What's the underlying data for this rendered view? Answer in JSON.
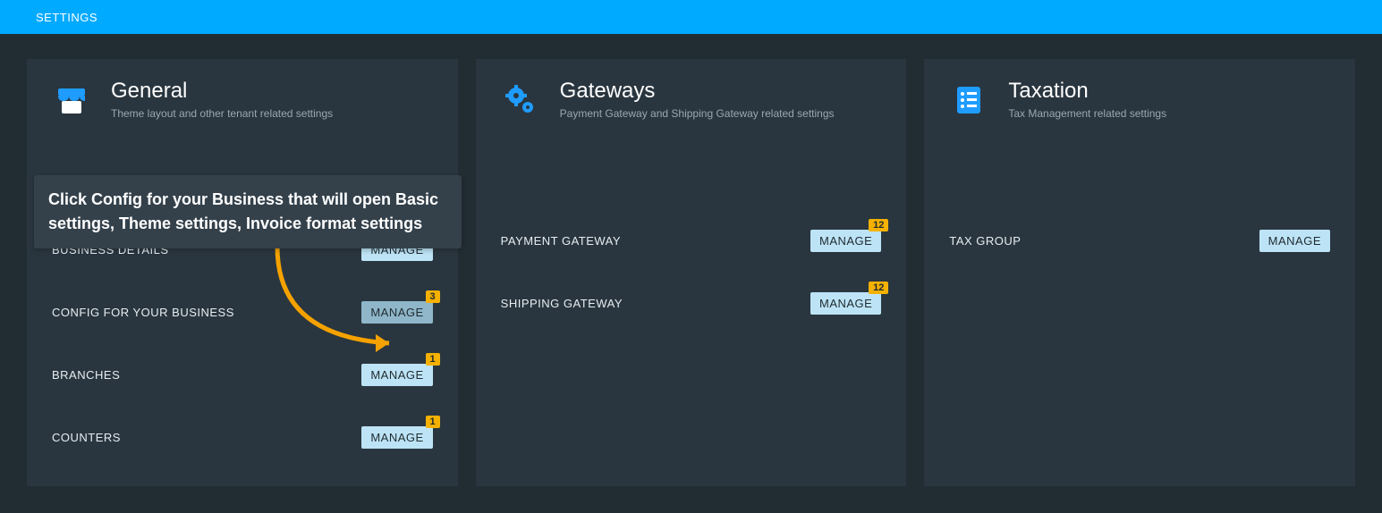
{
  "topbar": {
    "title": "SETTINGS"
  },
  "tooltip": "Click Config for your Business that will open Basic settings, Theme settings, Invoice format settings",
  "cards": {
    "general": {
      "title": "General",
      "subtitle": "Theme layout and other tenant related settings",
      "rows": [
        {
          "label": "BUSINESS DETAILS",
          "btn": "MANAGE",
          "badge": ""
        },
        {
          "label": "CONFIG FOR YOUR BUSINESS",
          "btn": "MANAGE",
          "badge": "3"
        },
        {
          "label": "BRANCHES",
          "btn": "MANAGE",
          "badge": "1"
        },
        {
          "label": "COUNTERS",
          "btn": "MANAGE",
          "badge": "1"
        }
      ]
    },
    "gateways": {
      "title": "Gateways",
      "subtitle": "Payment Gateway and Shipping Gateway related settings",
      "rows": [
        {
          "label": "PAYMENT GATEWAY",
          "btn": "MANAGE",
          "badge": "12"
        },
        {
          "label": "SHIPPING GATEWAY",
          "btn": "MANAGE",
          "badge": "12"
        }
      ]
    },
    "taxation": {
      "title": "Taxation",
      "subtitle": "Tax Management related settings",
      "rows": [
        {
          "label": "TAX GROUP",
          "btn": "MANAGE",
          "badge": ""
        }
      ]
    }
  }
}
